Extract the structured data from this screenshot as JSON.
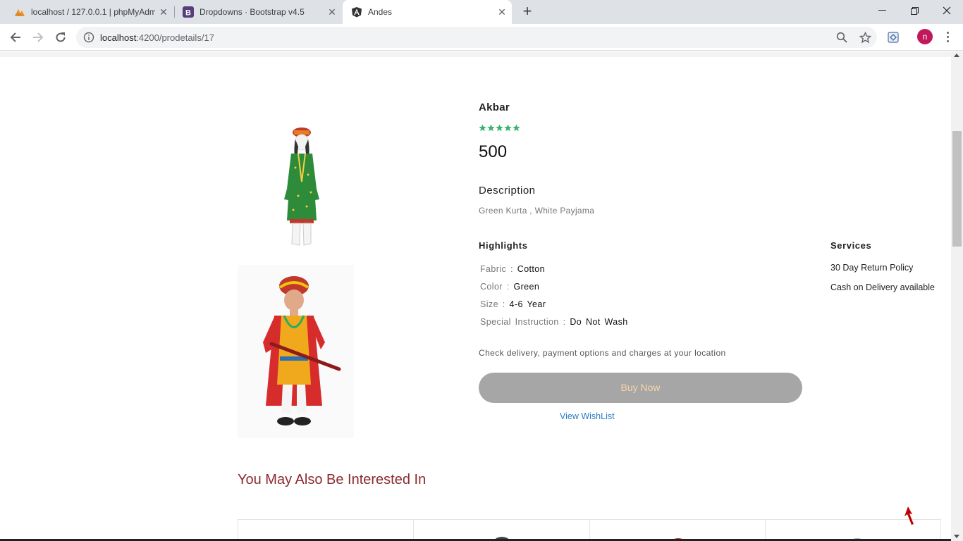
{
  "browser": {
    "tabs": [
      {
        "title": "localhost / 127.0.0.1 | phpMyAdm",
        "icon": "phpmyadmin-icon",
        "active": false
      },
      {
        "title": "Dropdowns · Bootstrap v4.5",
        "icon": "bootstrap-icon",
        "active": false
      },
      {
        "title": "Andes",
        "icon": "angular-icon",
        "active": true
      }
    ],
    "new_tab": "+",
    "url_host": "localhost",
    "url_path": ":4200/prodetails/17",
    "profile_initial": "n"
  },
  "product": {
    "name": "Akbar",
    "rating": 5,
    "rating_color": "#3cb371",
    "price": "500",
    "description_heading": "Description",
    "description": "Green Kurta , White Payjama",
    "highlights_heading": "Highlights",
    "specs": [
      {
        "label": "Fabric",
        "value": "Cotton"
      },
      {
        "label": "Color",
        "value": "Green"
      },
      {
        "label": "Size",
        "value": "4-6  Year"
      },
      {
        "label": "Special  Instruction",
        "value": "Do  Not  Wash"
      }
    ],
    "services_heading": "Services",
    "services": [
      "30 Day Return Policy",
      "Cash on Delivery available"
    ],
    "delivery_note": "Check delivery, payment options and charges at your location",
    "buy_label": "Buy Now",
    "wishlist_label": "View WishList"
  },
  "related": {
    "heading": "You May Also Be Interested In"
  },
  "colors": {
    "accent_heading": "#8b2a2f",
    "buy_button": "#a6a6a6",
    "link": "#2a7ac7"
  }
}
